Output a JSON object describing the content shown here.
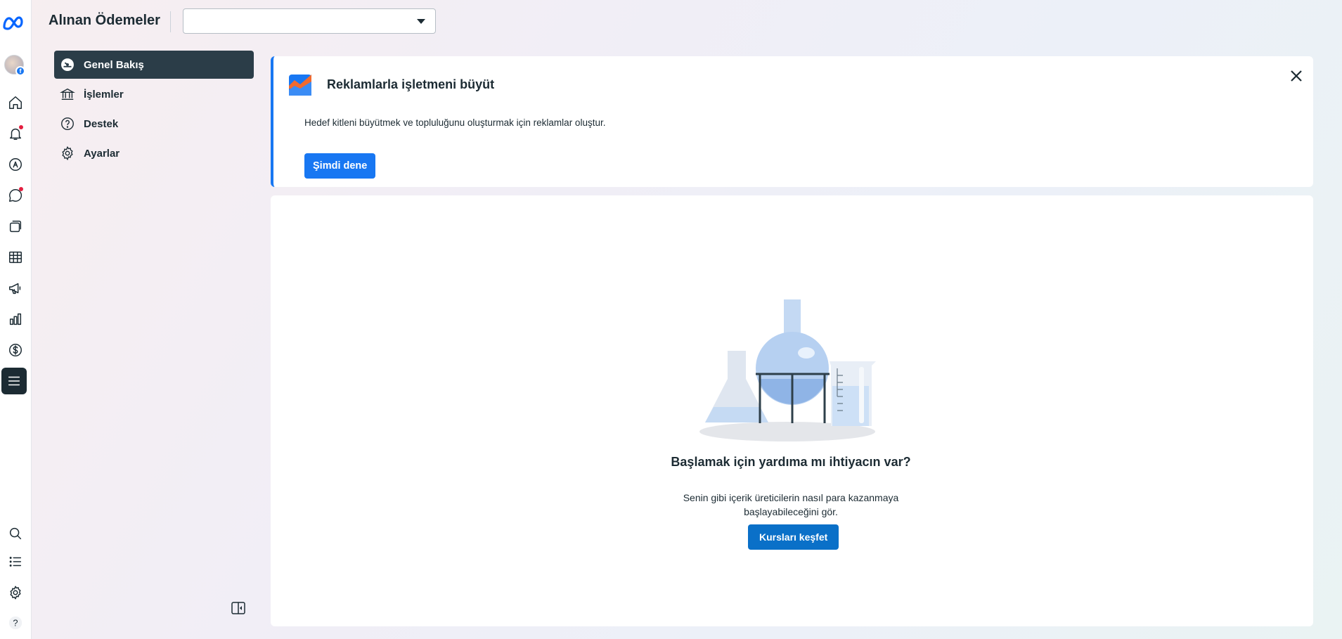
{
  "header": {
    "title": "Alınan Ödemeler",
    "account_select_value": ""
  },
  "rail": {
    "icons": [
      "meta-logo-icon",
      "avatar",
      "home-icon",
      "notifications-icon",
      "ads-icon",
      "messages-icon",
      "content-icon",
      "planner-icon",
      "megaphone-icon",
      "insights-icon",
      "monetization-icon",
      "menu-icon",
      "search-icon",
      "list-icon",
      "settings-icon",
      "help-icon"
    ]
  },
  "sidebar": {
    "items": [
      {
        "label": "Genel Bakış",
        "active": true
      },
      {
        "label": "İşlemler",
        "active": false
      },
      {
        "label": "Destek",
        "active": false
      },
      {
        "label": "Ayarlar",
        "active": false
      }
    ]
  },
  "promo": {
    "title": "Reklamlarla işletmeni büyüt",
    "description": "Hedef kitleni büyütmek ve topluluğunu oluşturmak için reklamlar oluştur.",
    "button_label": "Şimdi dene"
  },
  "empty_state": {
    "title": "Başlamak için yardıma mı ihtiyacın var?",
    "description": "Senin gibi içerik üreticilerin nasıl para kazanmaya başlayabileceğini gör.",
    "button_label": "Kursları keşfet"
  },
  "colors": {
    "primary": "#1877f2",
    "dark": "#1c2b33",
    "active_nav": "#2b3d48",
    "notification_dot": "#e41e3f"
  }
}
